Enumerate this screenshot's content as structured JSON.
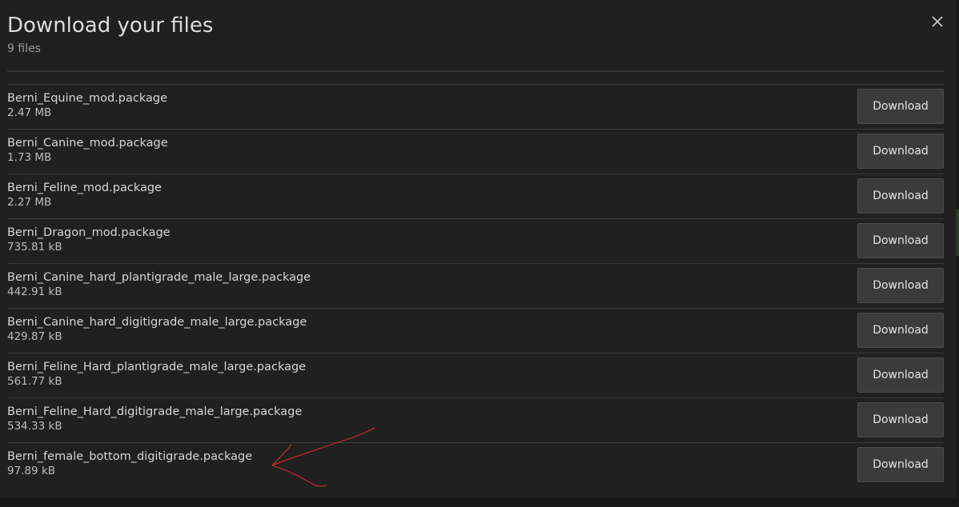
{
  "modal": {
    "title": "Download your files",
    "subtitle": "9 files",
    "close_icon": "close-icon"
  },
  "files": [
    {
      "name": "Berni_Equine_mod.package",
      "size": "2.47 MB",
      "button": "Download"
    },
    {
      "name": "Berni_Canine_mod.package",
      "size": "1.73 MB",
      "button": "Download"
    },
    {
      "name": "Berni_Feline_mod.package",
      "size": "2.27 MB",
      "button": "Download"
    },
    {
      "name": "Berni_Dragon_mod.package",
      "size": "735.81 kB",
      "button": "Download"
    },
    {
      "name": "Berni_Canine_hard_plantigrade_male_large.package",
      "size": "442.91 kB",
      "button": "Download"
    },
    {
      "name": "Berni_Canine_hard_digitigrade_male_large.package",
      "size": "429.87 kB",
      "button": "Download"
    },
    {
      "name": "Berni_Feline_Hard_plantigrade_male_large.package",
      "size": "561.77 kB",
      "button": "Download"
    },
    {
      "name": "Berni_Feline_Hard_digitigrade_male_large.package",
      "size": "534.33 kB",
      "button": "Download"
    },
    {
      "name": "Berni_female_bottom_digitigrade.package",
      "size": "97.89 kB",
      "button": "Download"
    }
  ],
  "annotation": {
    "icon": "hand-drawn-arrow-icon",
    "color": "#d42a2a"
  },
  "colors": {
    "background": "#202020",
    "button": "#3b3b3b",
    "text": "#d6d6d6"
  }
}
